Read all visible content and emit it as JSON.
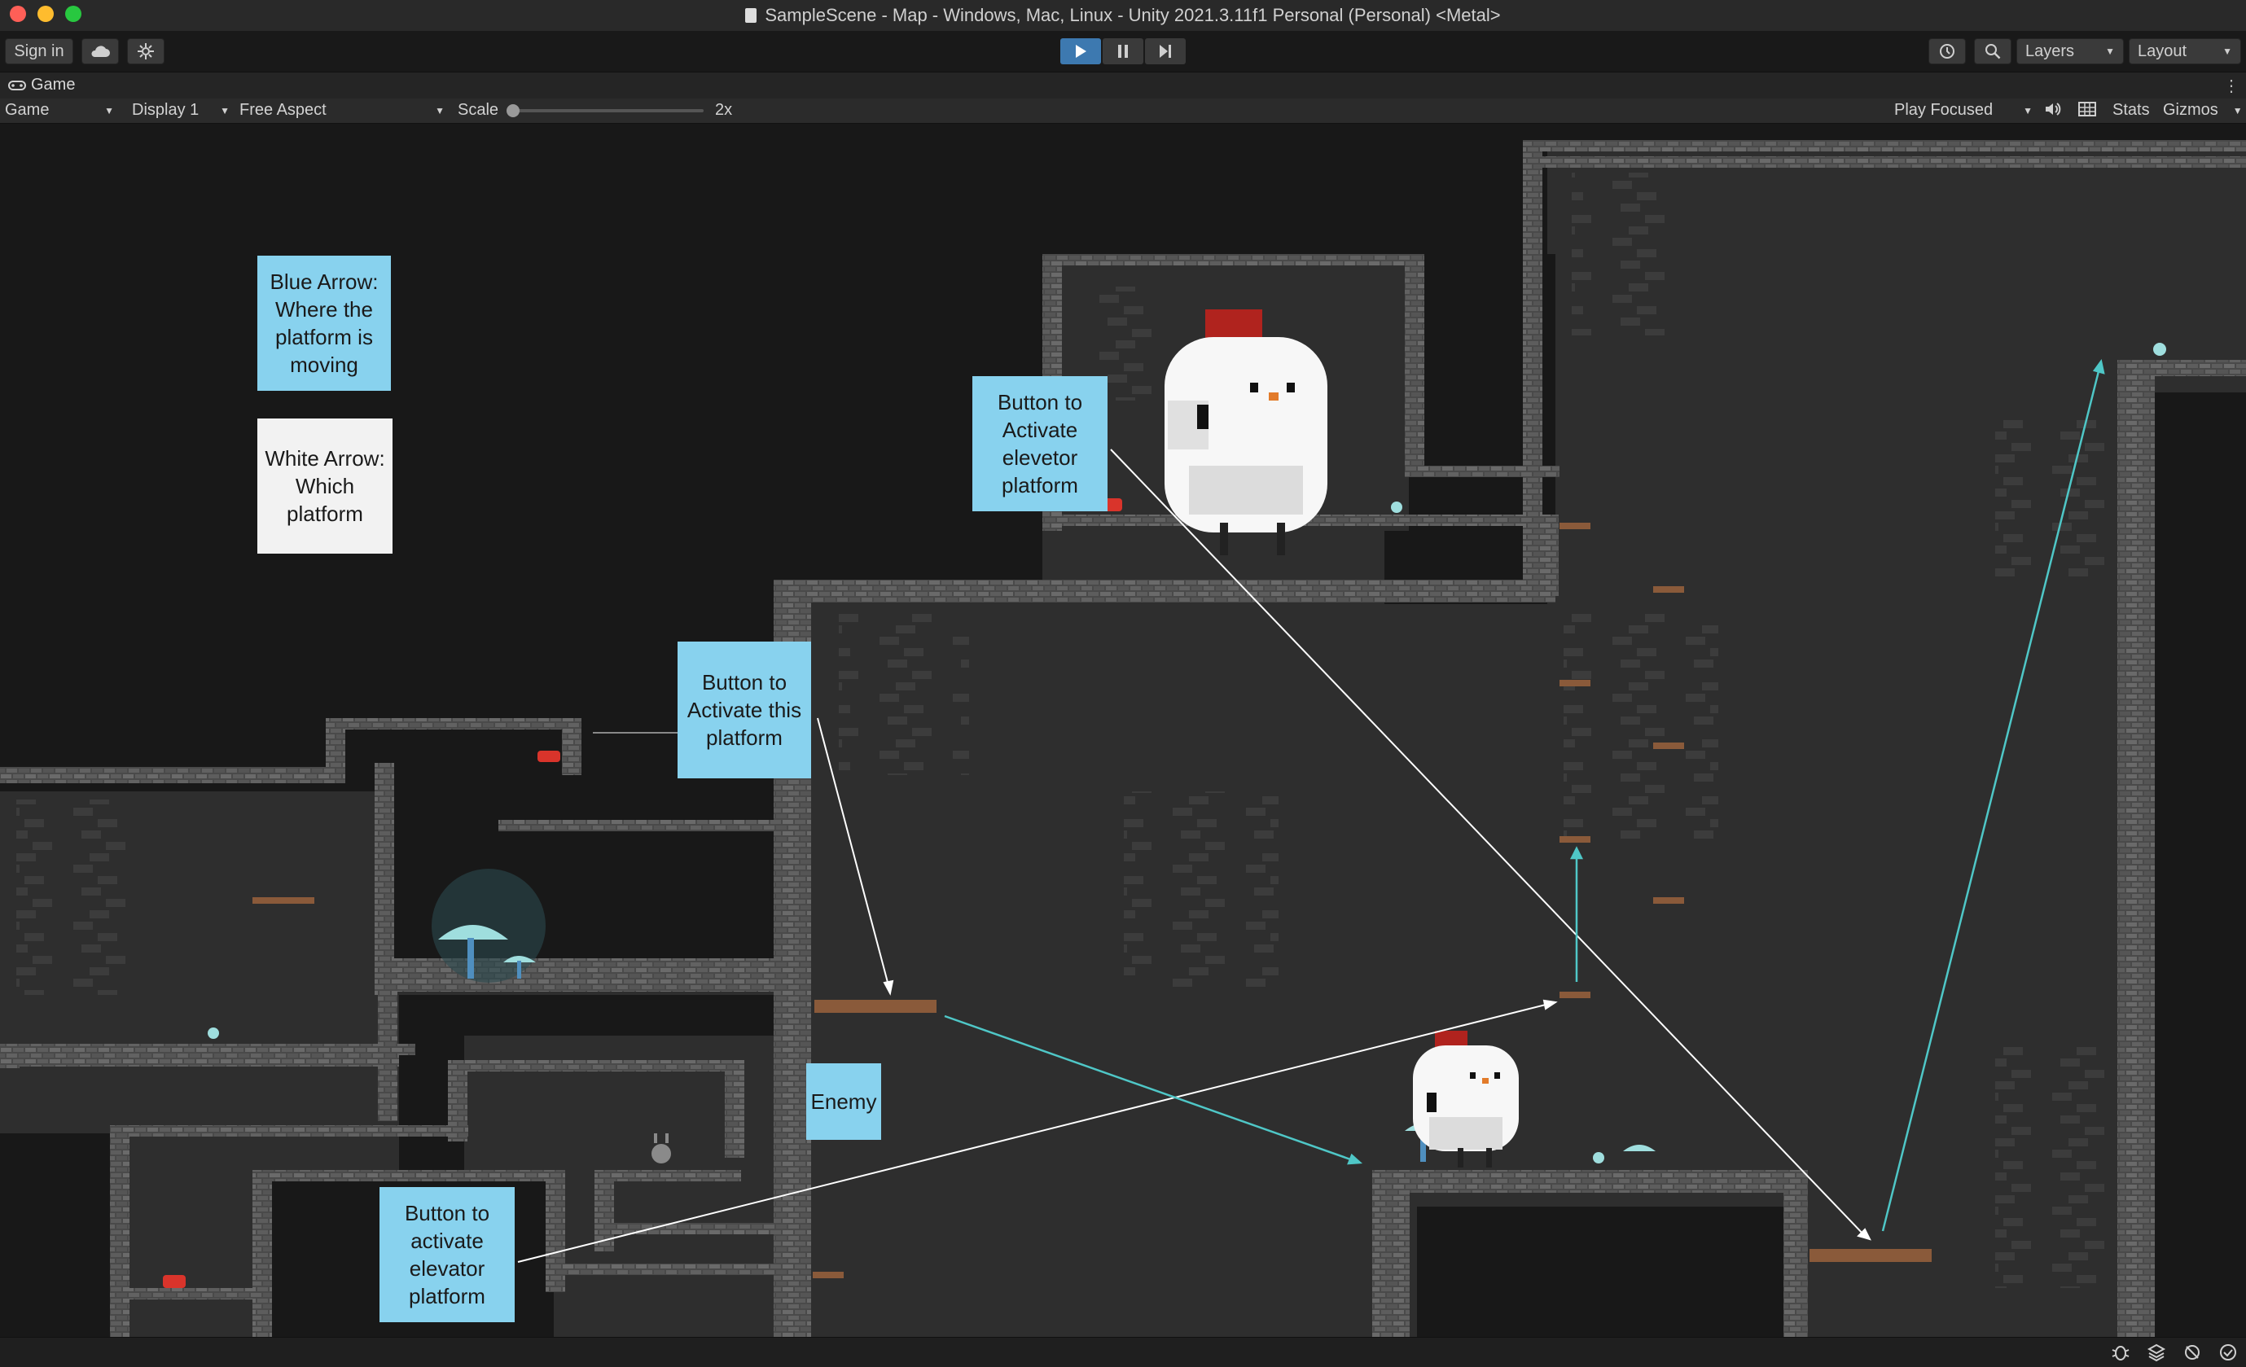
{
  "window": {
    "title": "SampleScene - Map - Windows, Mac, Linux - Unity 2021.3.11f1 Personal (Personal) <Metal>",
    "controls": [
      "close",
      "minimize",
      "maximize"
    ]
  },
  "toolbar": {
    "sign_in_label": "Sign in",
    "cloud_icon": "cloud-icon",
    "collab_icon": "collab-icon",
    "play_icon": "play-icon",
    "pause_icon": "pause-icon",
    "step_icon": "step-icon",
    "history_icon": "history-icon",
    "search_icon": "search-icon",
    "layers_label": "Layers",
    "layout_label": "Layout"
  },
  "game_tab": {
    "label": "Game",
    "icon": "gamepad-icon"
  },
  "game_toolbar": {
    "view_select": "Game",
    "display_select": "Display 1",
    "aspect_select": "Free Aspect",
    "scale_label": "Scale",
    "scale_value": "2x",
    "scale_level": 0.0,
    "play_mode_select": "Play Focused",
    "audio_icon": "speaker-icon",
    "stats_icon": "grid-icon",
    "stats_label": "Stats",
    "gizmos_label": "Gizmos"
  },
  "notes": {
    "legend_blue": "Blue Arrow: Where the platform is moving",
    "legend_white": "White Arrow: Which platform",
    "button_top": "Button to Activate elevetor platform",
    "button_middle": "Button to Activate this platform",
    "enemy": "Enemy",
    "button_bottom": "Button to activate elevator platform"
  },
  "colors": {
    "note_blue": "#88d2ee",
    "note_white": "#f2f2f2",
    "arrow_blue": "#4fc7c7",
    "arrow_white": "#ffffff",
    "play_active": "#3d79b0",
    "wall": "#4a4a4a",
    "room": "#2e2e2e",
    "platform": "#8a5a3a",
    "button_red": "#d9342b"
  },
  "statusbar": {
    "icons": [
      "bug-icon",
      "layers-stack-icon",
      "network-icon",
      "check-circle-icon"
    ]
  }
}
